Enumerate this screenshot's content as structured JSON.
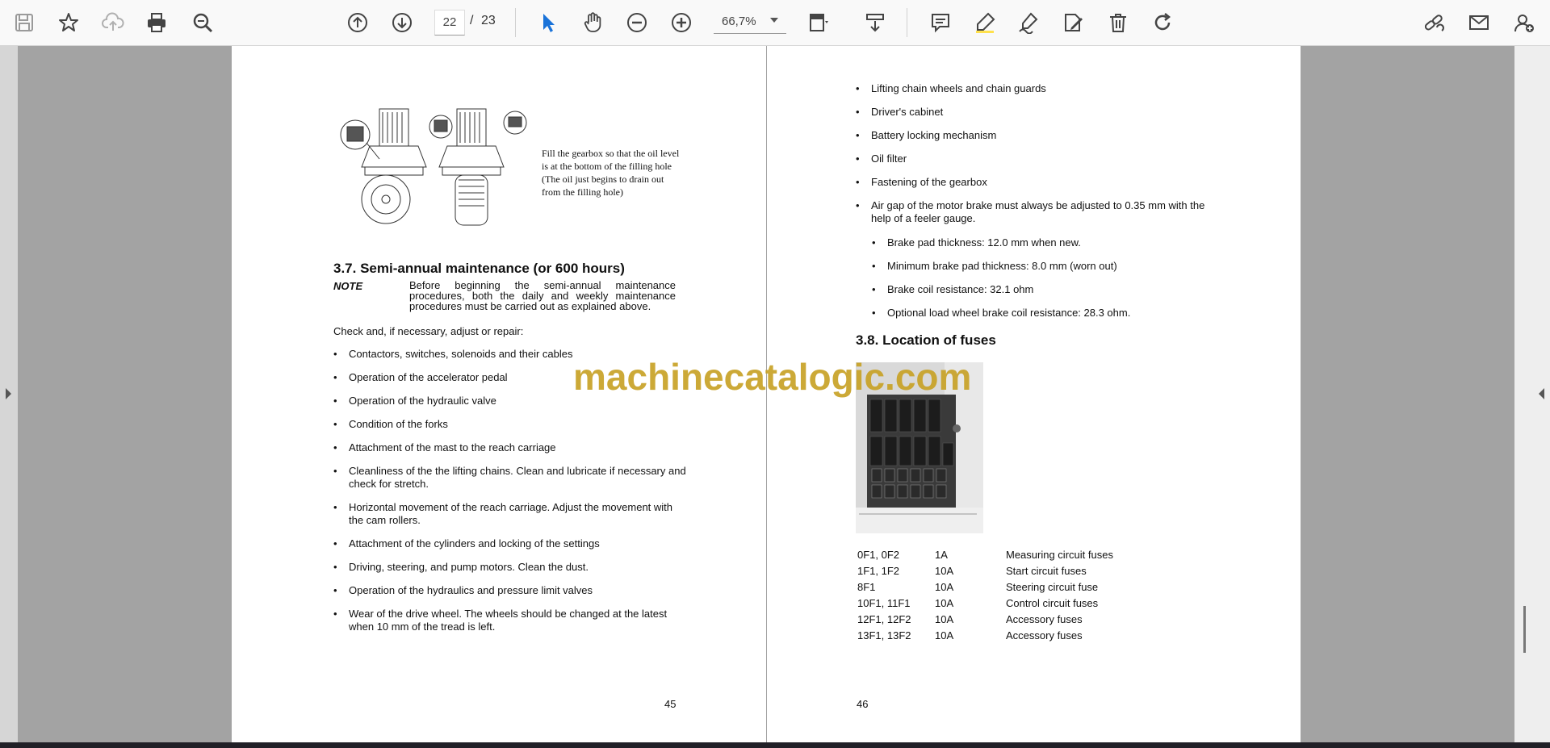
{
  "toolbar": {
    "page_current": "22",
    "page_separator": "/",
    "page_total": "23",
    "zoom": "66,7%",
    "icons": [
      "save-icon",
      "star-icon",
      "cloud-upload-icon",
      "print-icon",
      "zoom-search-icon",
      "arrow-up-icon",
      "arrow-down-icon",
      "select-cursor-icon",
      "hand-icon",
      "zoom-out-icon",
      "zoom-in-icon",
      "page-display-icon",
      "scroll-mode-icon",
      "comment-icon",
      "highlight-icon",
      "sign-icon",
      "edit-icon",
      "delete-icon",
      "rotate-icon",
      "link-icon",
      "mail-icon",
      "user-add-icon"
    ]
  },
  "left_page": {
    "figure_caption": [
      "Fill the gearbox so that the oil level",
      "is at the bottom of the filling hole",
      "(The oil just begins to drain out",
      "from the filling hole)"
    ],
    "heading": "3.7. Semi-annual maintenance (or 600 hours)",
    "note_label": "NOTE",
    "note_lines": [
      "Before beginning the semi-annual maintenance",
      "procedures, both the daily and weekly maintenance",
      "procedures must be carried out as explained above."
    ],
    "intro": "Check and, if necessary, adjust or repair:",
    "items": [
      "Contactors, switches, solenoids and their cables",
      "Operation of the accelerator pedal",
      "Operation of the hydraulic valve",
      "Condition of the forks",
      "Attachment of the mast to the reach carriage",
      "Cleanliness of the the lifting chains. Clean and lubricate if necessary and check for stretch.",
      "Horizontal movement of the reach carriage. Adjust the movement with the cam rollers.",
      "Attachment of the cylinders and locking of the settings",
      "Driving, steering, and pump motors. Clean the dust.",
      "Operation of the hydraulics and pressure limit valves",
      "Wear of the drive wheel. The wheels should be changed at the latest when 10 mm of the tread is left."
    ],
    "page_number": "45"
  },
  "right_page": {
    "items": [
      "Lifting chain wheels and chain guards",
      "Driver's cabinet",
      "Battery locking mechanism",
      "Oil filter",
      "Fastening of the gearbox",
      "Air gap of the motor brake must always be adjusted to 0.35 mm with the help of a feeler gauge."
    ],
    "sub_items": [
      "Brake pad thickness: 12.0 mm when new.",
      "Minimum brake pad thickness: 8.0 mm (worn out)",
      "Brake coil resistance: 32.1 ohm",
      "Optional load wheel brake coil resistance: 28.3 ohm."
    ],
    "heading": "3.8. Location of fuses",
    "fuses": [
      {
        "id": "0F1, 0F2",
        "rating": "1A",
        "desc": "Measuring circuit fuses"
      },
      {
        "id": "1F1, 1F2",
        "rating": "10A",
        "desc": "Start circuit fuses"
      },
      {
        "id": "8F1",
        "rating": "10A",
        "desc": "Steering circuit fuse"
      },
      {
        "id": "10F1, 11F1",
        "rating": "10A",
        "desc": "Control circuit fuses"
      },
      {
        "id": "12F1, 12F2",
        "rating": "10A",
        "desc": "Accessory fuses"
      },
      {
        "id": "13F1, 13F2",
        "rating": "10A",
        "desc": "Accessory fuses"
      }
    ],
    "page_number": "46"
  },
  "watermark": "machinecatalogic.com"
}
